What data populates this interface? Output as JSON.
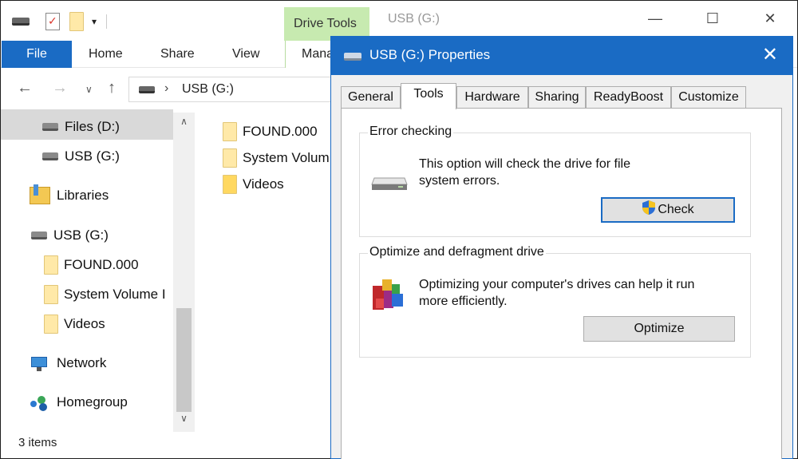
{
  "explorer": {
    "title": "USB (G:)",
    "context_tab": "Drive Tools",
    "ribbon_tabs": [
      "File",
      "Home",
      "Share",
      "View",
      "Manage"
    ],
    "address": {
      "crumb": "USB (G:)"
    },
    "nav": [
      {
        "label": "Files (D:)",
        "icon": "drive-icon"
      },
      {
        "label": "USB (G:)",
        "icon": "drive-icon"
      },
      {
        "label": "Libraries",
        "icon": "libraries-icon"
      },
      {
        "label": "USB (G:)",
        "icon": "usb-drive-icon",
        "selected": true
      },
      {
        "label": "FOUND.000",
        "icon": "folder-icon"
      },
      {
        "label": "System Volume I",
        "icon": "folder-icon"
      },
      {
        "label": "Videos",
        "icon": "folder-icon"
      },
      {
        "label": "Network",
        "icon": "network-icon"
      },
      {
        "label": "Homegroup",
        "icon": "homegroup-icon"
      }
    ],
    "files": [
      "FOUND.000",
      "System Volum",
      "Videos"
    ],
    "status": "3 items"
  },
  "dialog": {
    "title": "USB (G:) Properties",
    "tabs": [
      "General",
      "Tools",
      "Hardware",
      "Sharing",
      "ReadyBoost",
      "Customize"
    ],
    "active_tab": "Tools",
    "error_checking": {
      "legend": "Error checking",
      "line1": "This option will check the drive for file",
      "line2": "system errors.",
      "button": "Check"
    },
    "optimize": {
      "legend": "Optimize and defragment drive",
      "line1": "Optimizing your computer's drives can help it run",
      "line2": "more efficiently.",
      "button": "Optimize"
    }
  },
  "colors": {
    "accent": "#1a6bc4",
    "context_tab": "#c7eab0",
    "selection": "#d9d9d9"
  }
}
